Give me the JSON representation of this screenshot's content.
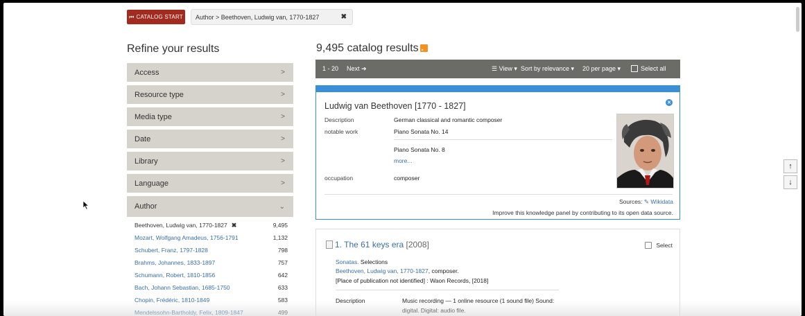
{
  "header": {
    "catalog_start": "CATALOG START",
    "breadcrumb": "Author > Beethoven, Ludwig van, 1770-1827",
    "remove": "✖"
  },
  "refine": {
    "title": "Refine your results",
    "facets": [
      "Access",
      "Resource type",
      "Media type",
      "Date",
      "Library",
      "Language"
    ],
    "author_facet": "Author",
    "authors": [
      {
        "name": "Beethoven, Ludwig van, 1770-1827",
        "count": "9,495"
      },
      {
        "name": "Mozart, Wolfgang Amadeus, 1756-1791",
        "count": "1,132"
      },
      {
        "name": "Schubert, Franz, 1797-1828",
        "count": "798"
      },
      {
        "name": "Brahms, Johannes, 1833-1897",
        "count": "757"
      },
      {
        "name": "Schumann, Robert, 1810-1856",
        "count": "642"
      },
      {
        "name": "Bach, Johann Sebastian, 1685-1750",
        "count": "633"
      },
      {
        "name": "Chopin, Frédéric, 1810-1849",
        "count": "583"
      },
      {
        "name": "Mendelssohn-Bartholdy, Felix, 1809-1847",
        "count": "499"
      }
    ]
  },
  "results": {
    "title": "9,495 catalog results",
    "toolbar": {
      "range": "1 - 20",
      "next": "Next ➔",
      "view": "☰ View ▾",
      "sort": "Sort by relevance ▾",
      "per_page": "20 per page ▾",
      "select_all": "Select all"
    }
  },
  "knowledge_panel": {
    "title": "Ludwig van Beethoven [1770 - 1827]",
    "description_label": "Description",
    "description": "German classical and romantic composer",
    "notable_label": "notable work",
    "notable_1": "Piano Sonata No. 14",
    "notable_2": "Piano Sonata No. 8",
    "more": "more...",
    "occupation_label": "occupation",
    "occupation": "composer",
    "sources_label": "Sources:",
    "sources_link": "Wikidata",
    "improve": "Improve this knowledge panel by contributing to its open data source."
  },
  "result_1": {
    "title": "1. The 61 keys era",
    "year": "[2008]",
    "select": "Select",
    "uniform_title_link": "Sonatas.",
    "uniform_title_rest": " Selections",
    "author_link": "Beethoven, Ludwig van, 1770-1827",
    "author_role": ", composer.",
    "publication": "[Place of publication not identified] : Waon Records, [2018]",
    "description_label": "Description",
    "description_1": "Music recording — 1 online resource (1 sound file) Sound:",
    "description_2": "digital. Digital: audio file."
  },
  "scroll": {
    "up": "↑",
    "down": "↓"
  },
  "icons": {
    "rss": "rss-icon",
    "portrait": "portrait-image",
    "close": "close-icon"
  },
  "colors": {
    "brand_red": "#a32a1e",
    "facet_bg": "#d6d3cd",
    "toolbar_bg": "#6b6b68",
    "panel_blue": "#3a8fd9",
    "link": "#3a6ea5"
  }
}
